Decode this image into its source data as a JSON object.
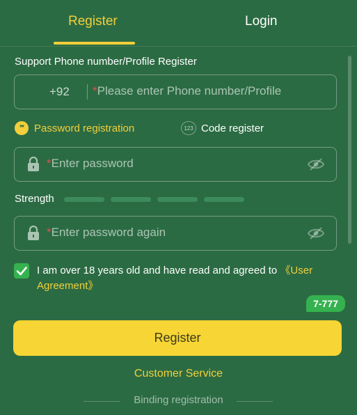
{
  "tabs": {
    "register": "Register",
    "login": "Login",
    "active": "register"
  },
  "phone_section": {
    "label": "Support Phone number/Profile Register",
    "country_code": "+92",
    "placeholder_required": "*",
    "placeholder": "Please enter Phone number/Profile"
  },
  "modes": {
    "password": {
      "icon_text": "**",
      "label": "Password registration"
    },
    "code": {
      "icon_text": "123",
      "label": "Code register"
    }
  },
  "password": {
    "required": "*",
    "placeholder": "Enter password"
  },
  "strength": {
    "label": "Strength"
  },
  "confirm_password": {
    "required": "*",
    "placeholder": "Enter password again"
  },
  "agreement": {
    "checked": true,
    "text": "I am over 18 years old and have read and agreed to ",
    "link_open": "《User",
    "link_close": "Agreement》"
  },
  "chip": {
    "label": "7-777"
  },
  "register_button": {
    "label": "Register"
  },
  "customer_service": {
    "label": "Customer Service"
  },
  "binding": {
    "label": "Binding registration"
  },
  "colors": {
    "background": "#2b6b43",
    "accent": "#f2cf3b",
    "button": "#f7d534",
    "checkbox": "#35b24f",
    "required": "#e05050"
  },
  "icons": [
    "lock-icon",
    "eye-off-icon",
    "check-icon",
    "dots-icon"
  ]
}
